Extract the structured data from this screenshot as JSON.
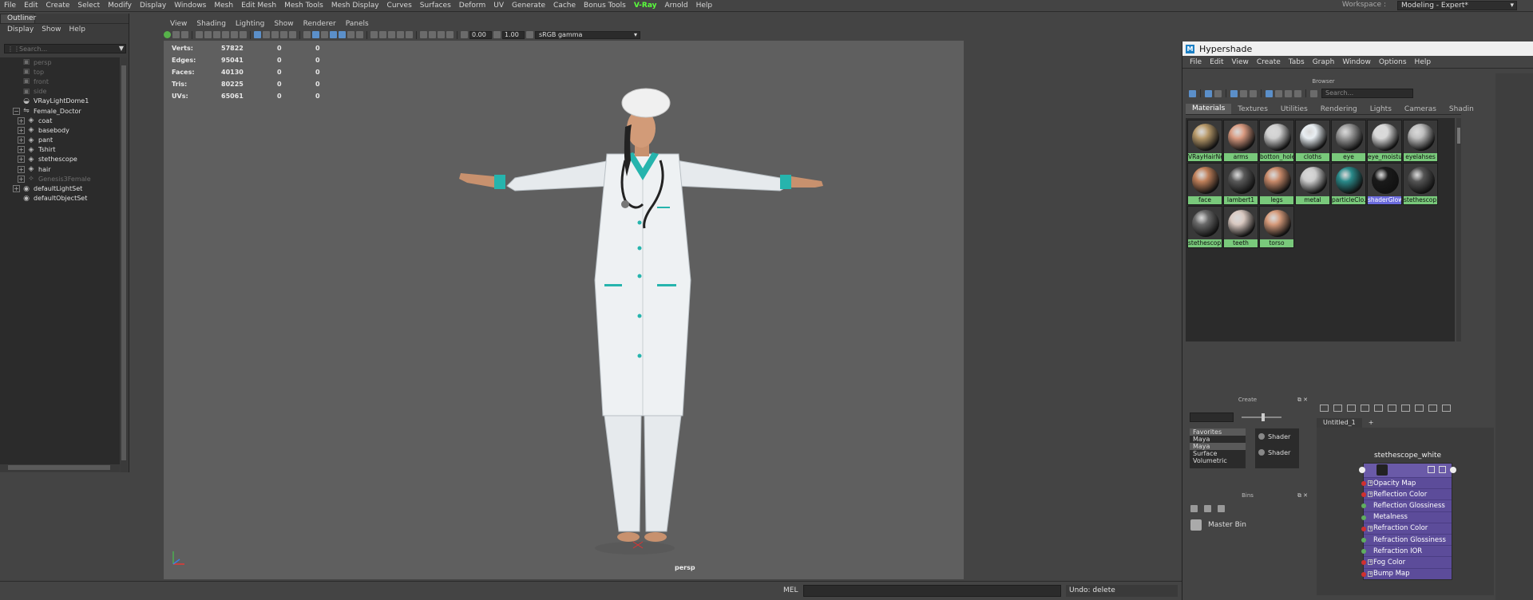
{
  "menubar": {
    "items": [
      "File",
      "Edit",
      "Create",
      "Select",
      "Modify",
      "Display",
      "Windows",
      "Mesh",
      "Edit Mesh",
      "Mesh Tools",
      "Mesh Display",
      "Curves",
      "Surfaces",
      "Deform",
      "UV",
      "Generate",
      "Cache",
      "Bonus Tools",
      "V-Ray",
      "Arnold",
      "Help"
    ],
    "workspace_label": "Workspace :",
    "workspace_value": "Modeling - Expert*"
  },
  "outliner": {
    "tab": "Outliner",
    "menu": [
      "Display",
      "Show",
      "Help"
    ],
    "search_placeholder": "Search...",
    "items": [
      {
        "label": "persp",
        "icon": "camera-icon",
        "dim": true,
        "expander": ""
      },
      {
        "label": "top",
        "icon": "camera-icon",
        "dim": true,
        "expander": ""
      },
      {
        "label": "front",
        "icon": "camera-icon",
        "dim": true,
        "expander": ""
      },
      {
        "label": "side",
        "icon": "camera-icon",
        "dim": true,
        "expander": ""
      },
      {
        "label": "VRayLightDome1",
        "icon": "dome-light-icon",
        "dim": false,
        "expander": ""
      },
      {
        "label": "Female_Doctor",
        "icon": "group-icon",
        "dim": false,
        "expander": "−"
      },
      {
        "label": "coat",
        "icon": "mesh-icon",
        "dim": false,
        "expander": "+"
      },
      {
        "label": "basebody",
        "icon": "mesh-icon",
        "dim": false,
        "expander": "+"
      },
      {
        "label": "pant",
        "icon": "mesh-icon",
        "dim": false,
        "expander": "+"
      },
      {
        "label": "Tshirt",
        "icon": "mesh-icon",
        "dim": false,
        "expander": "+"
      },
      {
        "label": "stethescope",
        "icon": "mesh-icon",
        "dim": false,
        "expander": "+"
      },
      {
        "label": "hair",
        "icon": "mesh-icon",
        "dim": false,
        "expander": "+"
      },
      {
        "label": "Genesis3Female",
        "icon": "joint-icon",
        "dim": true,
        "expander": "+"
      },
      {
        "label": "defaultLightSet",
        "icon": "set-icon",
        "dim": false,
        "expander": "+"
      },
      {
        "label": "defaultObjectSet",
        "icon": "set-icon",
        "dim": false,
        "expander": ""
      }
    ]
  },
  "viewport": {
    "menu": [
      "View",
      "Shading",
      "Lighting",
      "Show",
      "Renderer",
      "Panels"
    ],
    "exposure": "0.00",
    "gamma": "1.00",
    "color_space": "sRGB gamma",
    "hud": [
      {
        "k": "Verts:",
        "v": "57822",
        "a": "0",
        "b": "0"
      },
      {
        "k": "Edges:",
        "v": "95041",
        "a": "0",
        "b": "0"
      },
      {
        "k": "Faces:",
        "v": "40130",
        "a": "0",
        "b": "0"
      },
      {
        "k": "Tris:",
        "v": "80225",
        "a": "0",
        "b": "0"
      },
      {
        "k": "UVs:",
        "v": "65061",
        "a": "0",
        "b": "0"
      }
    ],
    "camera_label": "persp"
  },
  "bottom": {
    "mel_label": "MEL",
    "status": "Undo: delete"
  },
  "hypershade": {
    "title": "Hypershade",
    "menu": [
      "File",
      "Edit",
      "View",
      "Create",
      "Tabs",
      "Graph",
      "Window",
      "Options",
      "Help"
    ],
    "browser_title": "Browser",
    "search_placeholder": "Search...",
    "tabs": [
      "Materials",
      "Textures",
      "Utilities",
      "Rendering",
      "Lights",
      "Cameras",
      "Shadin"
    ],
    "materials": [
      {
        "name": "VRayHairNe...",
        "color": "#b89a6a",
        "sel": false
      },
      {
        "name": "arms",
        "color": "#d99a80",
        "sel": false
      },
      {
        "name": "botton_hole",
        "color": "#cfcfcf",
        "sel": false
      },
      {
        "name": "cloths",
        "color": "#e8eef2",
        "sel": false
      },
      {
        "name": "eye",
        "color": "#9a9a9a",
        "sel": false
      },
      {
        "name": "eye_moisture",
        "color": "#d8d8d8",
        "sel": false
      },
      {
        "name": "eyelahses",
        "color": "#bdbdbd",
        "sel": false
      },
      {
        "name": "face",
        "color": "#c0805a",
        "sel": false
      },
      {
        "name": "lambert1",
        "color": "#5a5a5a",
        "sel": false
      },
      {
        "name": "legs",
        "color": "#c88a6a",
        "sel": false
      },
      {
        "name": "metal",
        "color": "#cccccc",
        "sel": false
      },
      {
        "name": "particleClo...",
        "color": "#2a8a8a",
        "sel": false
      },
      {
        "name": "shaderGlow1",
        "color": "#1a1a1a",
        "sel": true
      },
      {
        "name": "stethescop...",
        "color": "#555555",
        "sel": false
      },
      {
        "name": "stethescop...",
        "color": "#6a6a6a",
        "sel": false
      },
      {
        "name": "teeth",
        "color": "#d8c8c0",
        "sel": false
      },
      {
        "name": "torso",
        "color": "#d59a7a",
        "sel": false
      }
    ],
    "create_title": "Create",
    "create_tree": [
      "Favorites",
      "Maya",
      "Maya",
      "Surface",
      "Volumetric"
    ],
    "create_list": [
      "Shader",
      "Shader"
    ],
    "bins_title": "Bins",
    "master_bin": "Master Bin",
    "node_editor_tab": "Untitled_1",
    "node_editor_add": "+",
    "node": {
      "title": "stethescope_white",
      "attrs": [
        {
          "label": "Opacity Map",
          "port": "#d03030",
          "plus": true
        },
        {
          "label": "Reflection Color",
          "port": "#d03030",
          "plus": true
        },
        {
          "label": "Reflection Glossiness",
          "port": "#5fae5f",
          "plus": false
        },
        {
          "label": "Metalness",
          "port": "#5fae5f",
          "plus": false
        },
        {
          "label": "Refraction Color",
          "port": "#d03030",
          "plus": true
        },
        {
          "label": "Refraction Glossiness",
          "port": "#5fae5f",
          "plus": false
        },
        {
          "label": "Refraction IOR",
          "port": "#5fae5f",
          "plus": false
        },
        {
          "label": "Fog Color",
          "port": "#d03030",
          "plus": true
        },
        {
          "label": "Bump Map",
          "port": "#d03030",
          "plus": true
        }
      ]
    }
  }
}
